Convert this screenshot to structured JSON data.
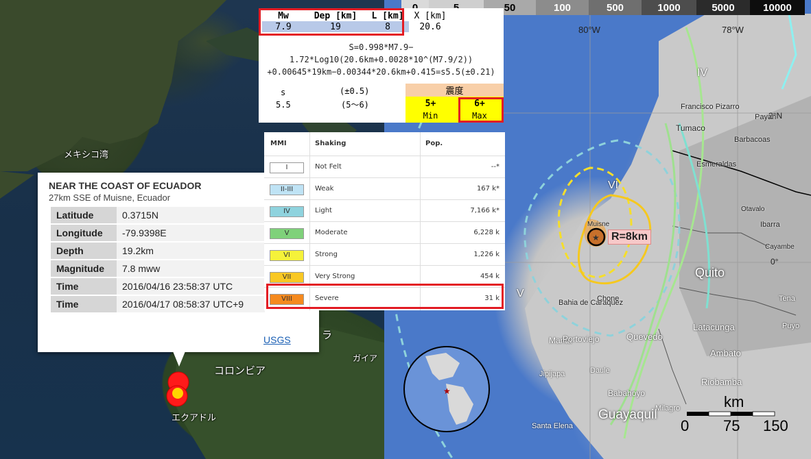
{
  "left_map": {
    "labels": {
      "gulf_mexico": "メキシコ湾",
      "colombia": "コロンビア",
      "ecuador": "エクアドル",
      "guyana": "ガイア",
      "venezuela_partial": "ラ"
    }
  },
  "info_popup": {
    "title": "NEAR THE COAST OF ECUADOR",
    "subtitle": "27km SSE of Muisne, Ecuador",
    "rows": [
      {
        "key": "Latitude",
        "value": "0.3715N"
      },
      {
        "key": "Longitude",
        "value": "-79.9398E"
      },
      {
        "key": "Depth",
        "value": "19.2km"
      },
      {
        "key": "Magnitude",
        "value": "7.8 mww"
      },
      {
        "key": "Time",
        "value": "2016/04/16 23:58:37 UTC"
      },
      {
        "key": "Time",
        "value": "2016/04/17 08:58:37 UTC+9"
      }
    ],
    "link": "USGS"
  },
  "formula_panel": {
    "headers": [
      "Mw",
      "Dep [km]",
      "L [km]",
      "X [km]"
    ],
    "values": [
      "7.9",
      "19",
      "8",
      "20.6"
    ],
    "formula_lines": [
      "S=0.998*M7.9−",
      "1.72*Log10(20.6km+0.0028*10^(M7.9/2))",
      "+0.00645*19km−0.00344*20.6km+0.415=s5.5(±0.21)"
    ],
    "s_label": "s",
    "s_value": "5.5",
    "range_label": "(±0.5)",
    "range_value": "(5〜6)",
    "shindo_header": "震度",
    "shindo_min": "5+",
    "shindo_max": "6+",
    "min_label": "Min",
    "max_label": "Max"
  },
  "mmi_table": {
    "headers": [
      "MMI",
      "Shaking",
      "Pop."
    ],
    "rows": [
      {
        "mmi": "I",
        "shaking": "Not Felt",
        "pop": "--*",
        "color": "#ffffff"
      },
      {
        "mmi": "II-III",
        "shaking": "Weak",
        "pop": "167 k*",
        "color": "#bfe3f5"
      },
      {
        "mmi": "IV",
        "shaking": "Light",
        "pop": "7,166 k*",
        "color": "#8fd3de"
      },
      {
        "mmi": "V",
        "shaking": "Moderate",
        "pop": "6,228 k",
        "color": "#7fd17a"
      },
      {
        "mmi": "VI",
        "shaking": "Strong",
        "pop": "1,226 k",
        "color": "#f5f23a"
      },
      {
        "mmi": "VII",
        "shaking": "Very Strong",
        "pop": "454 k",
        "color": "#f9c824"
      },
      {
        "mmi": "VIII",
        "shaking": "Severe",
        "pop": "31 k",
        "color": "#f58a1f"
      }
    ]
  },
  "right_map": {
    "elevation_scale": [
      "0",
      "5",
      "50",
      "100",
      "500",
      "1000",
      "5000",
      "10000"
    ],
    "elevation_colors": [
      "#dadada",
      "#cfcfcf",
      "#a9a9a9",
      "#8c8c8c",
      "#6f6f6f",
      "#4d4d4d",
      "#2b2b2b",
      "#0d0d0d"
    ],
    "lon_labels": [
      "80°W",
      "78°W"
    ],
    "lat_labels": [
      "2°N",
      "0°"
    ],
    "contour_labels": [
      "VI",
      "V",
      "IV"
    ],
    "rupture_label": "R=8km",
    "cities": [
      "Francisco Pizarro",
      "Payan",
      "Tumaco",
      "Barbacoas",
      "Esmeraldas",
      "Muisne",
      "Bahia de Caraquez",
      "Manta",
      "Portoviejo",
      "Quito",
      "Latacunga",
      "Ambato",
      "Quevedo",
      "Guayaquil",
      "Riobamba",
      "Babahoyo",
      "Santa Elena",
      "Ibarra",
      "Otavalo",
      "Cayambe",
      "Chone",
      "Jipijapa",
      "Milagro",
      "Daule",
      "Puyo",
      "Tena"
    ],
    "scale_unit": "km",
    "scale_ticks": [
      "0",
      "75",
      "150"
    ]
  }
}
